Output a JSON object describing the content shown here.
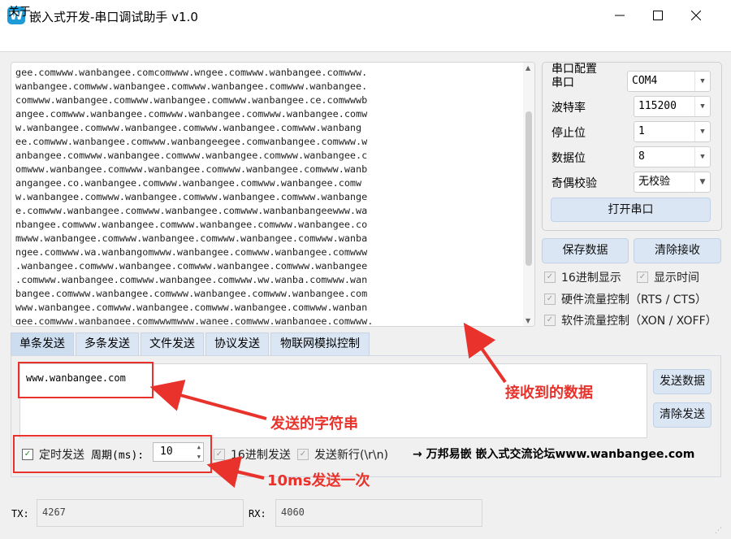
{
  "window": {
    "title": "嵌入式开发-串口调试助手 v1.0",
    "icon_letter": "W",
    "menu_about": "关于"
  },
  "receive": {
    "lines": [
      "gee.comwww.wanbangee.comcomwww.wngee.comwww.wanbangee.comwww.",
      "wanbangee.comwww.wanbangee.comwww.wanbangee.comwww.wanbangee.",
      "comwww.wanbangee.comwww.wanbangee.comwww.wanbangee.ce.comwwwb",
      "angee.comwww.wanbangee.comwww.wanbangee.comwww.wanbangee.comw",
      "w.wanbangee.comwww.wanbangee.comwww.wanbangee.comwww.wanbang",
      "ee.comwww.wanbangee.comwww.wanbangeegee.comwanbangee.comwww.w",
      "anbangee.comwww.wanbangee.comwww.wanbangee.comwww.wanbangee.c",
      "omwww.wanbangee.comwww.wanbangee.comwww.wanbangee.comwww.wanb",
      "angangee.co.wanbangee.comwww.wanbangee.comwww.wanbangee.comw",
      "w.wanbangee.comwww.wanbangee.comwww.wanbangee.comwww.wanbange",
      "e.comwww.wanbangee.comwww.wanbangee.comwww.wanbanbangeewww.wa",
      "nbangee.comwww.wanbangee.comwww.wanbangee.comwww.wanbangee.co",
      "mwww.wanbangee.comwww.wanbangee.comwww.wanbangee.comwww.wanba",
      "ngee.comwww.wa.wanbangomwww.wanbangee.comwww.wanbangee.comwww",
      ".wanbangee.comwww.wanbangee.comwww.wanbangee.comwww.wanbangee",
      ".comwww.wanbangee.comwww.wanbangee.comwww.ww.wanba.comwww.wan",
      "bangee.comwww.wanbangee.comwww.wanbangee.comwww.wanbangee.com",
      "www.wanbangee.comwww.wanbangee.comwww.wanbangee.comwww.wanban",
      "gee.comwww.wanbangee.comwwwmwww.wanee.comwww.wanbangee.comwww."
    ]
  },
  "config": {
    "group_title": "串口配置",
    "port_label": "串口",
    "port_value": "COM4",
    "baud_label": "波特率",
    "baud_value": "115200",
    "stop_label": "停止位",
    "stop_value": "1",
    "data_label": "数据位",
    "data_value": "8",
    "parity_label": "奇偶校验",
    "parity_value": "无校验",
    "open_button": "打开串口",
    "save_button": "保存数据",
    "clear_recv_button": "清除接收",
    "hex_display": "16进制显示",
    "show_time": "显示时间",
    "hw_flow": "硬件流量控制（RTS / CTS）",
    "sw_flow": "软件流量控制（XON / XOFF）"
  },
  "tabs": [
    "单条发送",
    "多条发送",
    "文件发送",
    "协议发送",
    "物联网模拟控制"
  ],
  "send": {
    "text": "www.wanbangee.com",
    "send_button": "发送数据",
    "clear_button": "清除发送",
    "timed_send": "定时发送",
    "period_label": "周期(ms):",
    "period_value": "10",
    "hex_send": "16进制发送",
    "newline": "发送新行(\\r\\n)",
    "footer": "→ 万邦易嵌  嵌入式交流论坛www.wanbangee.com"
  },
  "status": {
    "tx_label": "TX:",
    "tx_value": "4267",
    "rx_label": "RX:",
    "rx_value": "4060"
  },
  "annotations": {
    "received": "接收到的数据",
    "sent_string": "发送的字符串",
    "interval": "10ms发送一次"
  },
  "colors": {
    "accent": "#1e9bd7",
    "annotation": "#e8322b",
    "button": "#dbe6f4"
  }
}
